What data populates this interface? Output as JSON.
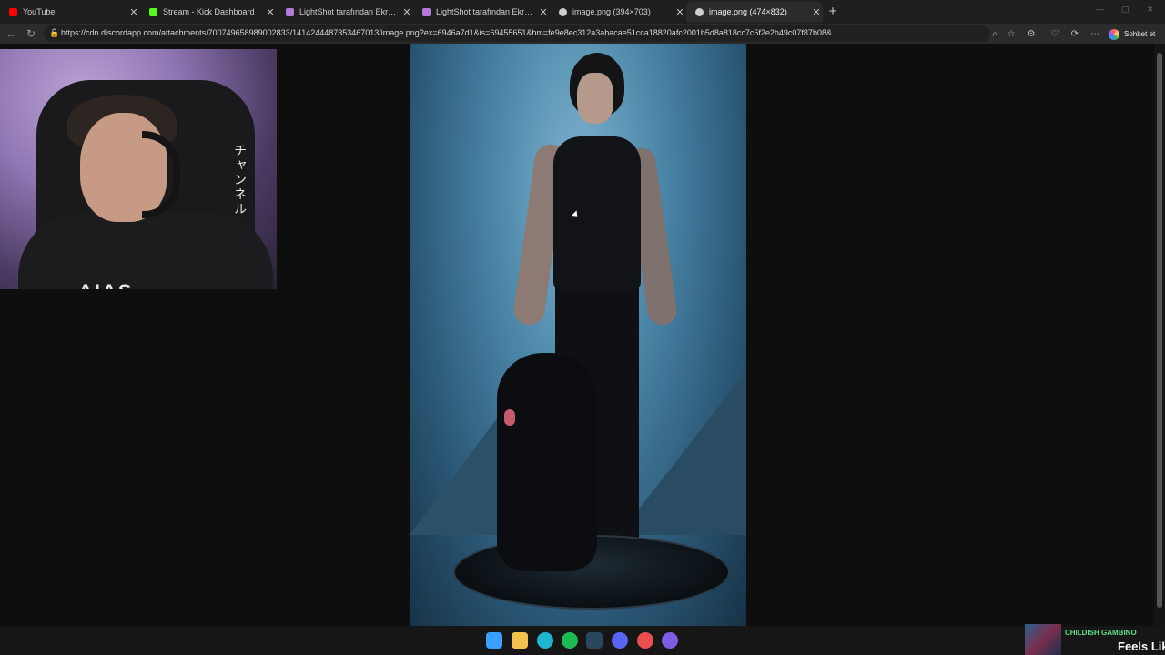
{
  "tabs": [
    {
      "title": "YouTube",
      "favicon_color": "#ff0000",
      "active": false
    },
    {
      "title": "Stream - Kick Dashboard",
      "favicon_color": "#53fc18",
      "active": false
    },
    {
      "title": "LightShot tarafından Ekran Görün",
      "favicon_color": "#b07ad6",
      "active": false
    },
    {
      "title": "LightShot tarafından Ekran Görün",
      "favicon_color": "#b07ad6",
      "active": false
    },
    {
      "title": "image.png (394×703)",
      "favicon_color": "#cfcfcf",
      "active": false
    },
    {
      "title": "image.png (474×832)",
      "favicon_color": "#cfcfcf",
      "active": true
    }
  ],
  "tab_close_glyph": "✕",
  "new_tab_glyph": "+",
  "address": {
    "url": "https://cdn.discordapp.com/attachments/700749658989002833/1414244487353467013/image.png?ex=6946a7d1&is=69455651&hm=fe9e8ec312a3abacae51cca18820afc2001b5d8a818cc7c5f2e2b49c07f87b08&"
  },
  "nav_icons": [
    "back-icon",
    "reload-icon"
  ],
  "toolbar_icons": [
    "zoom-icon",
    "favorite-star-icon",
    "extensions-icon",
    "browser-essentials-icon",
    "performance-icon",
    "more-menu-icon"
  ],
  "copilot": {
    "label": "Sohbet et"
  },
  "webcam": {
    "chair_text": "チャンネル",
    "hoodie_text": "AIAS"
  },
  "taskbar_icons": [
    {
      "name": "windows-start-icon",
      "color": "#3aa0ff"
    },
    {
      "name": "file-explorer-icon",
      "color": "#f2c14e"
    },
    {
      "name": "edge-browser-icon",
      "color": "#1fb6d0"
    },
    {
      "name": "spotify-icon",
      "color": "#1db954"
    },
    {
      "name": "steam-icon",
      "color": "#2a475e"
    },
    {
      "name": "discord-icon",
      "color": "#5865f2"
    },
    {
      "name": "app-icon",
      "color": "#e94f4f"
    },
    {
      "name": "obs-icon",
      "color": "#7d5ce6"
    }
  ],
  "now_playing": {
    "artist": "CHILDISH GAMBINO",
    "song": "Feels Lik"
  },
  "colors": {
    "accent": "#1fb6d0",
    "nowplaying_accent": "#5fe08c"
  }
}
